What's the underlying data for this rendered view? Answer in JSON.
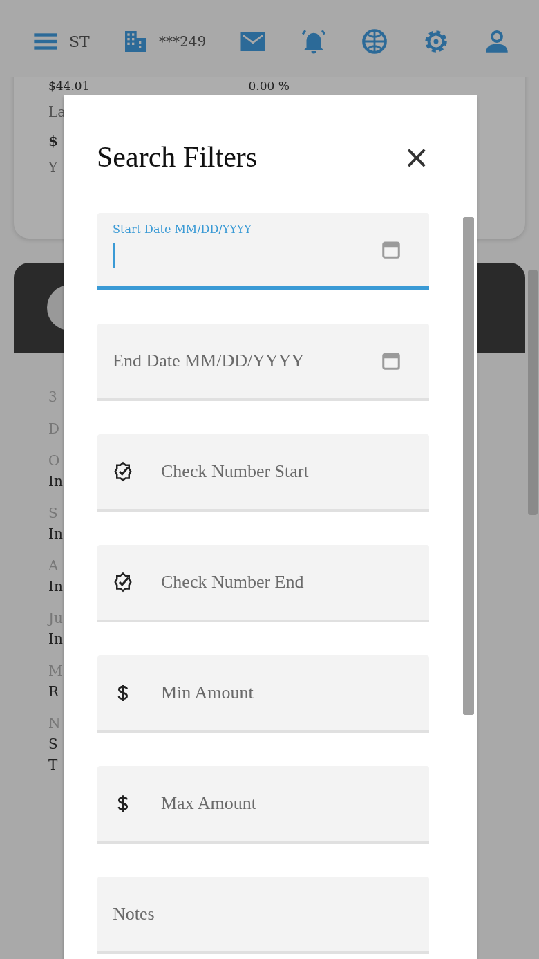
{
  "header": {
    "initials": "ST",
    "account": "***249"
  },
  "background": {
    "card_values": [
      "$44.01",
      "0.00 %"
    ],
    "card_rows": [
      "La",
      "$",
      "Y"
    ],
    "rows": [
      {
        "kind": "label",
        "text": "3"
      },
      {
        "kind": "label",
        "text": "D"
      },
      {
        "kind": "label",
        "text": "O"
      },
      {
        "kind": "value",
        "text": "In"
      },
      {
        "kind": "label",
        "text": "S"
      },
      {
        "kind": "value",
        "text": "In"
      },
      {
        "kind": "label",
        "text": "A"
      },
      {
        "kind": "value",
        "text": "In"
      },
      {
        "kind": "label",
        "text": "Ju"
      },
      {
        "kind": "value",
        "text": "In"
      },
      {
        "kind": "label",
        "text": "M"
      },
      {
        "kind": "value",
        "text": "R"
      },
      {
        "kind": "label",
        "text": "N"
      },
      {
        "kind": "value",
        "text": "S"
      },
      {
        "kind": "value",
        "text": "T"
      }
    ]
  },
  "dialog": {
    "title": "Search Filters",
    "close": "×",
    "fields": [
      {
        "kind": "date",
        "placeholder": "Start Date MM/DD/YYYY",
        "focused": true
      },
      {
        "kind": "date",
        "placeholder": "End Date MM/DD/YYYY",
        "focused": false
      },
      {
        "kind": "check",
        "placeholder": "Check Number Start",
        "focused": false
      },
      {
        "kind": "check",
        "placeholder": "Check Number End",
        "focused": false
      },
      {
        "kind": "amount",
        "placeholder": "Min Amount",
        "focused": false
      },
      {
        "kind": "amount",
        "placeholder": "Max Amount",
        "focused": false
      },
      {
        "kind": "text",
        "placeholder": "Notes",
        "focused": false
      }
    ]
  }
}
